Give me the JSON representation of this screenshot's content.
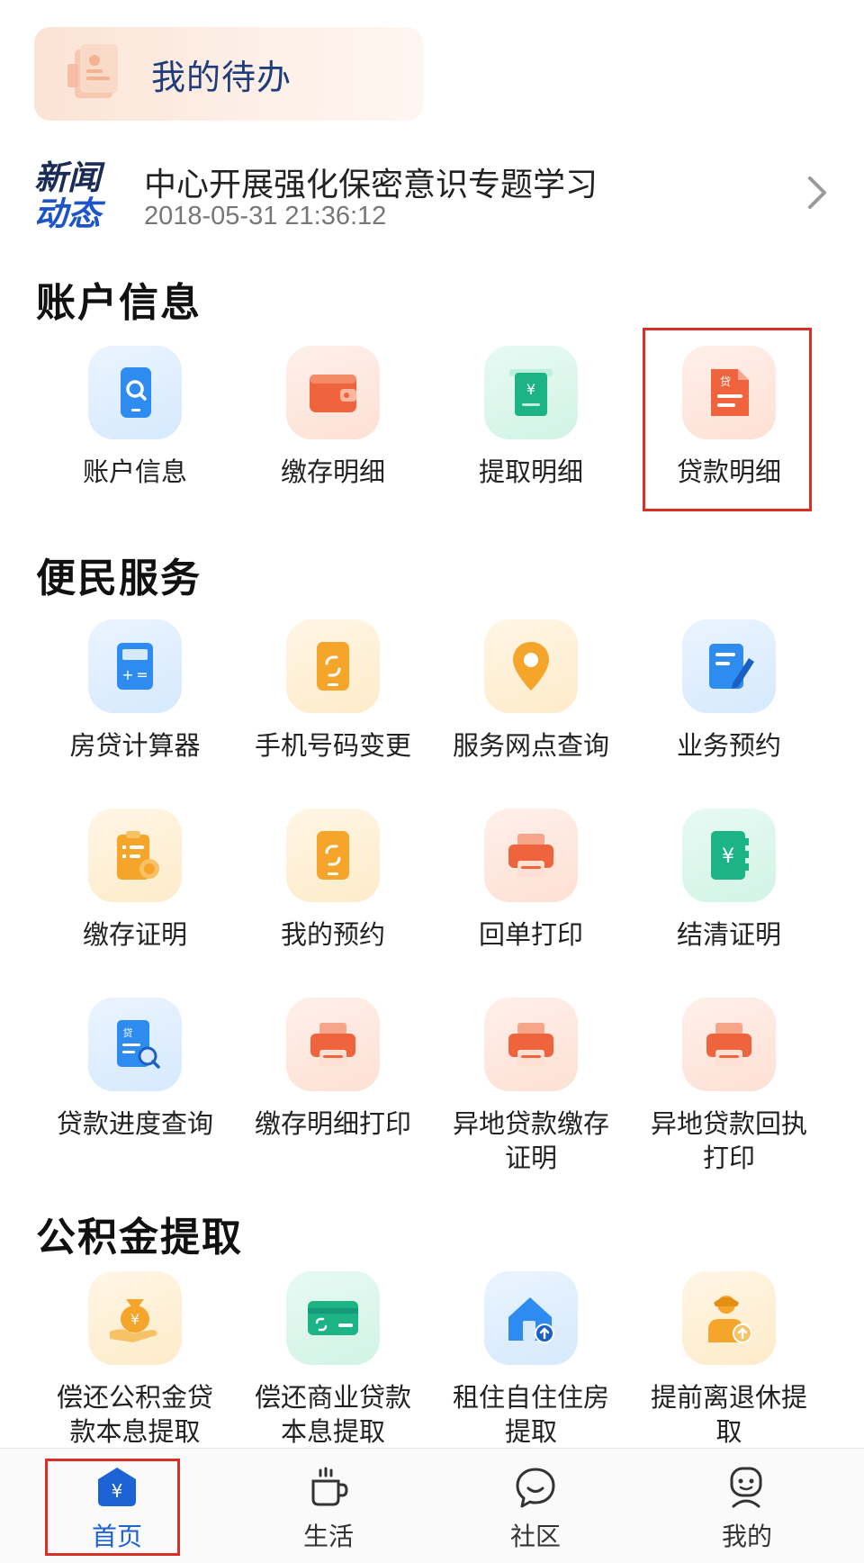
{
  "todo": {
    "title": "我的待办"
  },
  "news": {
    "logo_line1": "新闻",
    "logo_line2": "动态",
    "headline": "中心开展强化保密意识专题学习",
    "date": "2018-05-31 21:36:12"
  },
  "sections": {
    "account": "账户信息",
    "services": "便民服务",
    "withdraw": "公积金提取"
  },
  "account_items": [
    {
      "label": "账户信息",
      "icon": "phone-search-icon"
    },
    {
      "label": "缴存明细",
      "icon": "wallet-icon"
    },
    {
      "label": "提取明细",
      "icon": "cash-withdraw-icon"
    },
    {
      "label": "贷款明细",
      "icon": "loan-document-icon"
    }
  ],
  "service_items": [
    {
      "label": "房贷计算器",
      "icon": "calculator-icon"
    },
    {
      "label": "手机号码变更",
      "icon": "phone-change-icon"
    },
    {
      "label": "服务网点查询",
      "icon": "location-pin-icon"
    },
    {
      "label": "业务预约",
      "icon": "edit-document-icon"
    },
    {
      "label": "缴存证明",
      "icon": "clipboard-certificate-icon"
    },
    {
      "label": "我的预约",
      "icon": "phone-change-icon"
    },
    {
      "label": "回单打印",
      "icon": "printer-icon"
    },
    {
      "label": "结清证明",
      "icon": "yen-notebook-icon"
    },
    {
      "label": "贷款进度查询",
      "icon": "loan-receipt-search-icon"
    },
    {
      "label": "缴存明细打印",
      "icon": "printer-icon"
    },
    {
      "label": "异地贷款缴存证明",
      "icon": "printer-icon"
    },
    {
      "label": "异地贷款回执打印",
      "icon": "printer-icon"
    }
  ],
  "withdraw_items": [
    {
      "label": "偿还公积金贷款本息提取",
      "icon": "money-bag-hand-icon"
    },
    {
      "label": "偿还商业贷款本息提取",
      "icon": "bank-card-icon"
    },
    {
      "label": "租住自住住房提取",
      "icon": "house-icon"
    },
    {
      "label": "提前离退休提取",
      "icon": "retiree-icon"
    }
  ],
  "tabs": [
    {
      "label": "首页",
      "icon": "home-yen-icon",
      "active": true
    },
    {
      "label": "生活",
      "icon": "coffee-cup-icon",
      "active": false
    },
    {
      "label": "社区",
      "icon": "chat-bubble-icon",
      "active": false
    },
    {
      "label": "我的",
      "icon": "profile-icon",
      "active": false
    }
  ],
  "colors": {
    "accent_blue": "#1d63d6",
    "highlight_red": "#d93025",
    "icon_orange": "#f0643d",
    "icon_green": "#1db485",
    "icon_yellow": "#f4a52a",
    "icon_blue": "#2e8cf0"
  }
}
